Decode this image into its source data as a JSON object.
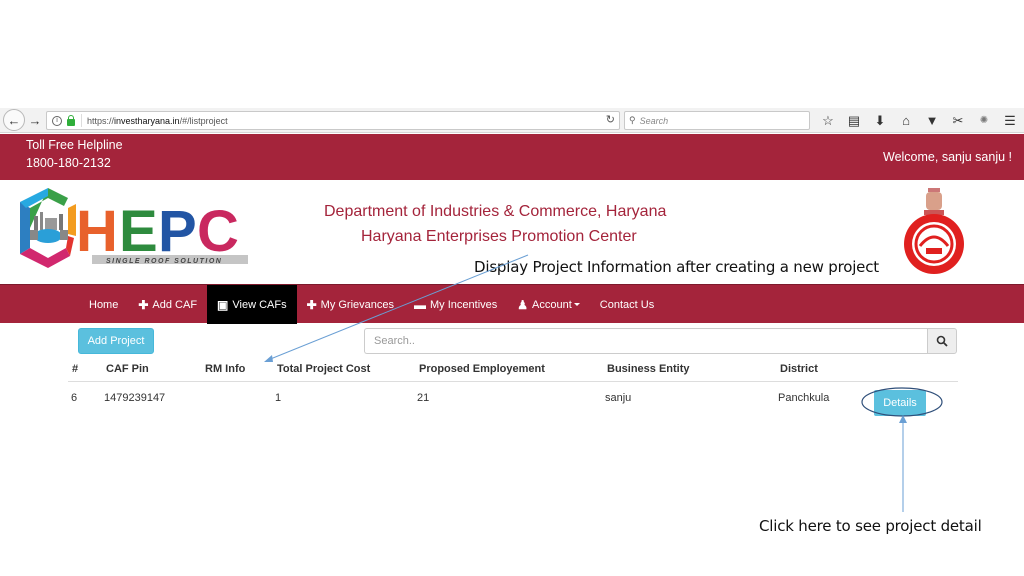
{
  "browser": {
    "url_prefix": "https://",
    "url_domain": "investharyana.in",
    "url_path": "/#/listproject",
    "search_placeholder": "Search",
    "toolbar_icons": [
      "star-icon",
      "reading-list-icon",
      "download-icon",
      "home-icon",
      "pocket-icon",
      "screenshot-icon",
      "extension-icon",
      "menu-icon"
    ]
  },
  "topbar": {
    "helpline_title": "Toll Free Helpline",
    "helpline_number": "1800-180-2132",
    "welcome": "Welcome, sanju sanju !"
  },
  "header": {
    "logo_text": "HEPC",
    "logo_tagline": "SINGLE ROOF SOLUTION",
    "dept_title": "Department of Industries & Commerce, Haryana",
    "center_title": "Haryana Enterprises Promotion Center"
  },
  "nav": {
    "items": [
      {
        "label": "Home",
        "icon": ""
      },
      {
        "label": "Add CAF",
        "icon": "plus-icon"
      },
      {
        "label": "View CAFs",
        "icon": "inbox-icon",
        "active": true
      },
      {
        "label": "My Grievances",
        "icon": "plus-icon"
      },
      {
        "label": "My Incentives",
        "icon": "folder-icon"
      },
      {
        "label": "Account",
        "icon": "user-icon",
        "dropdown": true
      },
      {
        "label": "Contact Us",
        "icon": ""
      }
    ]
  },
  "content": {
    "add_project_label": "Add Project",
    "search_placeholder": "Search..",
    "table": {
      "columns": [
        "#",
        "CAF Pin",
        "RM Info",
        "Total Project Cost",
        "Proposed Employement",
        "Business Entity",
        "District",
        ""
      ],
      "rows": [
        {
          "id": "6",
          "caf_pin": "1479239147",
          "rm_info": "",
          "total_project_cost": "1",
          "proposed_employment": "21",
          "business_entity": "sanju",
          "district": "Panchkula",
          "action": "Details"
        }
      ]
    }
  },
  "annotations": {
    "top": "Display Project Information after creating a new project",
    "bottom": "Click here to see project detail",
    "arrow_color": "#6a9fd4",
    "ellipse_color": "#2f4f7a"
  },
  "colors": {
    "brand_red": "#a4243b",
    "info_blue": "#5bc0de",
    "active_nav": "#000000"
  }
}
